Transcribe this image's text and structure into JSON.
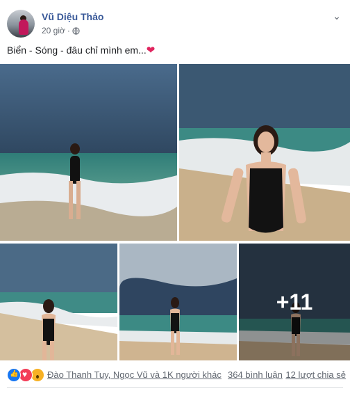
{
  "post": {
    "author": "Vũ Diệu Thảo",
    "time": "20 giờ",
    "text": "Biển - Sóng - đâu chỉ mình em...",
    "heart": "❤"
  },
  "photos": {
    "more_count": "+11"
  },
  "reactions": {
    "types": [
      "like-icon",
      "love-icon",
      "wow-icon"
    ],
    "reactors": "Đào Thanh Tuy, Ngọc Vũ và 1K người khác",
    "comments": "364 bình luận",
    "shares": "12 lượt chia sẻ"
  },
  "colors": {
    "author_link": "#385898",
    "meta_text": "#616770",
    "like_blue": "#1877f2",
    "love_red": "#f33e58",
    "wow_yellow": "#f7b125"
  }
}
